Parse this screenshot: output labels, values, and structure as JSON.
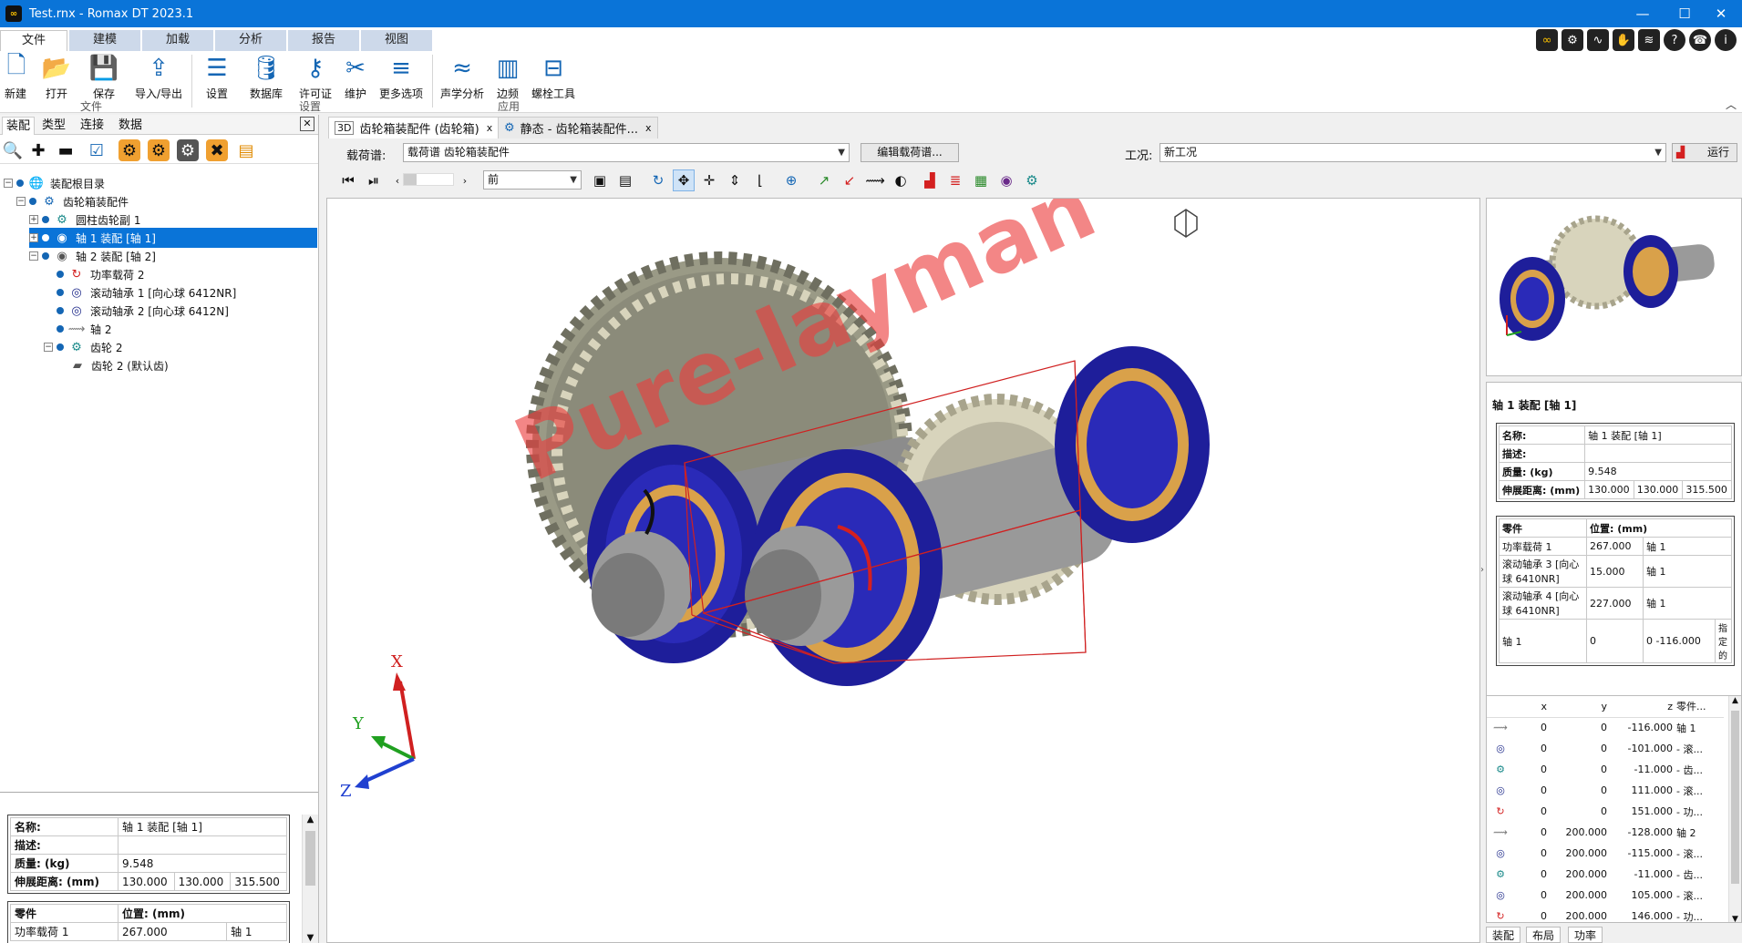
{
  "window": {
    "title": "Test.rnx -  Romax DT 2023.1",
    "app_icon": "∞"
  },
  "ribbon": {
    "tabs": [
      "文件",
      "建模",
      "加载",
      "分析",
      "报告",
      "视图"
    ],
    "buttons": {
      "new": "新建",
      "open": "打开",
      "save": "保存",
      "import_export": "导入/导出",
      "settings": "设置",
      "database": "数据库",
      "license": "许可证",
      "maintenance": "维护",
      "more_options": "更多选项",
      "acoustic": "声学分析",
      "sideband": "边频",
      "bolt_tool": "螺栓工具"
    },
    "groups": {
      "file": "文件",
      "settings": "设置",
      "application": "应用"
    }
  },
  "left_panel": {
    "tabs": [
      "装配",
      "类型",
      "连接",
      "数据"
    ],
    "tree": [
      {
        "label": "装配根目录",
        "icon": "globe-icon"
      },
      {
        "label": "齿轮箱装配件",
        "icon": "gearbox-assembly-icon"
      },
      {
        "label": "圆柱齿轮副 1",
        "icon": "gear-pair-icon"
      },
      {
        "label": "轴 1 装配 [轴 1]",
        "icon": "shaft-assembly-icon"
      },
      {
        "label": "轴 2 装配 [轴 2]",
        "icon": "shaft-assembly-icon"
      },
      {
        "label": "功率载荷 2",
        "icon": "power-load-icon"
      },
      {
        "label": "滚动轴承 1 [向心球 6412NR]",
        "icon": "bearing-icon"
      },
      {
        "label": "滚动轴承 2 [向心球 6412N]",
        "icon": "bearing-icon"
      },
      {
        "label": "轴 2",
        "icon": "shaft-icon"
      },
      {
        "label": "齿轮 2",
        "icon": "gear-icon"
      },
      {
        "label": "齿轮 2 (默认齿)",
        "icon": "gear-tooth-icon"
      }
    ],
    "props": {
      "name_k": "名称:",
      "name_v": "轴 1 装配 [轴 1]",
      "desc_k": "描述:",
      "desc_v": "",
      "mass_k": "质量: (kg)",
      "mass_v": "9.548",
      "extent_k": "伸展距离: (mm)",
      "extent_v": [
        "130.000",
        "130.000",
        "315.500"
      ],
      "part_k": "零件",
      "pos_k": "位置: (mm)",
      "row1_part": "功率载荷 1",
      "row1_pos": "267.000",
      "row1_ref": "轴 1"
    }
  },
  "doc_tabs": [
    {
      "prefix": "3D",
      "label": "齿轮箱装配件 (齿轮箱)",
      "close": "x"
    },
    {
      "prefix": "",
      "label": "静态 - 齿轮箱装配件...",
      "close": "x"
    }
  ],
  "loadbar": {
    "load_case_label": "载荷谱:",
    "load_case_value": "载荷谱 齿轮箱装配件",
    "edit_button": "编辑载荷谱...",
    "condition_label": "工况:",
    "condition_value": "新工况",
    "run_button": "运行"
  },
  "viewbar": {
    "view_select": "前"
  },
  "viewport": {
    "watermark": "Pure-layman",
    "axes": {
      "x": "X",
      "y": "Y",
      "z": "Z"
    }
  },
  "right_panel": {
    "title": "轴 1 装配 [轴 1]",
    "name_k": "名称:",
    "name_v": "轴 1 装配 [轴 1]",
    "desc_k": "描述:",
    "mass_k": "质量: (kg)",
    "mass_v": "9.548",
    "extent_k": "伸展距离: (mm)",
    "extent_v": [
      "130.000",
      "130.000",
      "315.500"
    ],
    "parts_header": [
      "零件",
      "位置: (mm)"
    ],
    "parts": [
      {
        "name": "功率载荷 1",
        "pos": "267.000",
        "ref": "轴 1",
        "extra": ""
      },
      {
        "name": "滚动轴承 3 [向心球 6410NR]",
        "pos": "15.000",
        "ref": "轴 1",
        "extra": ""
      },
      {
        "name": "滚动轴承 4 [向心球 6410NR]",
        "pos": "227.000",
        "ref": "轴 1",
        "extra": ""
      },
      {
        "name": "轴 1",
        "pos": "0",
        "ref": "0",
        "extra": "-116.000",
        "note": "指定的"
      }
    ],
    "coords_header": [
      "",
      "x",
      "y",
      "z",
      "零件..."
    ],
    "coords": [
      {
        "icon": "shaft-icon",
        "x": "0",
        "y": "0",
        "z": "-116.000",
        "part": "轴 1"
      },
      {
        "icon": "bearing-icon",
        "x": "0",
        "y": "0",
        "z": "-101.000",
        "part": "- 滚..."
      },
      {
        "icon": "gear-icon",
        "x": "0",
        "y": "0",
        "z": "-11.000",
        "part": "- 齿..."
      },
      {
        "icon": "bearing-icon",
        "x": "0",
        "y": "0",
        "z": "111.000",
        "part": "- 滚..."
      },
      {
        "icon": "power-load-icon",
        "x": "0",
        "y": "0",
        "z": "151.000",
        "part": "- 功..."
      },
      {
        "icon": "shaft-icon",
        "x": "0",
        "y": "200.000",
        "z": "-128.000",
        "part": "轴 2"
      },
      {
        "icon": "bearing-icon",
        "x": "0",
        "y": "200.000",
        "z": "-115.000",
        "part": "- 滚..."
      },
      {
        "icon": "gear-icon",
        "x": "0",
        "y": "200.000",
        "z": "-11.000",
        "part": "- 齿..."
      },
      {
        "icon": "bearing-icon",
        "x": "0",
        "y": "200.000",
        "z": "105.000",
        "part": "- 滚..."
      },
      {
        "icon": "power-load-icon",
        "x": "0",
        "y": "200.000",
        "z": "146.000",
        "part": "- 功..."
      }
    ],
    "bottom_tabs": [
      "装配",
      "布局",
      "功率"
    ]
  }
}
